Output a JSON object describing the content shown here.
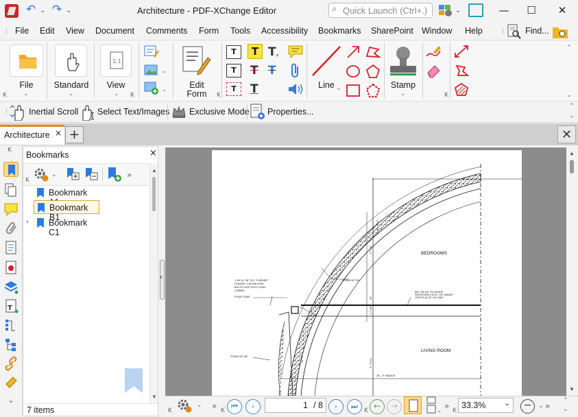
{
  "window": {
    "title": "Architecture - PDF-XChange Editor",
    "quick_launch_placeholder": "Quick Launch (Ctrl+.)",
    "minimize": "—",
    "maximize": "☐",
    "close": "✕"
  },
  "menu": [
    "File",
    "Edit",
    "View",
    "Document",
    "Comments",
    "Form",
    "Tools",
    "Accessibility",
    "Bookmarks",
    "SharePoint",
    "Window",
    "Help"
  ],
  "menu_find": "Find...",
  "ribbon": {
    "file": "File",
    "standard": "Standard",
    "view": "View",
    "edit_form_line1": "Edit",
    "edit_form_line2": "Form",
    "line": "Line",
    "stamp": "Stamp"
  },
  "toolbar2": {
    "inertial_scroll": "Inertial Scroll",
    "select_text": "Select Text/Images",
    "exclusive_mode": "Exclusive Mode",
    "properties": "Properties..."
  },
  "tabs": {
    "document_tab": "Architecture",
    "close_glyph": "×",
    "new_tab": "+",
    "close_doc": "✕"
  },
  "bookmarks": {
    "title": "Bookmarks",
    "close": "×",
    "items": [
      {
        "label": "Bookmark A1",
        "selected": false,
        "expandable": false
      },
      {
        "label": "Bookmark B1",
        "selected": true,
        "expandable": false
      },
      {
        "label": "Bookmark C1",
        "selected": false,
        "expandable": true
      }
    ],
    "count": "7 items"
  },
  "drawing": {
    "bedrooms": "BEDROOMS",
    "living_room": "LIVING ROOM",
    "note1_l1": "1 3/4\"x1 7/8\" SCL \"CURVED\"",
    "note1_l2": "LEDGER, C/W ANCHOR",
    "note1_l3": "BOLTS CAST INTO CONC",
    "note1_l4": "CORBEL",
    "pour_joint": "POUR JOINT",
    "form_set_b3": "FORM SET B3",
    "form_set_b2": "FORM SET B2",
    "plywood_l1": "5/8\" OR 3/4\" PLYWOOD",
    "plywood_l2": "SHEATHING ON 11 7/8\" MANUF.",
    "plywood_l3": "JOISTS @ 16\" O/C MAX",
    "radius": "18' - 0\" RADIUS",
    "dim1": "11' - 4 3/4\"",
    "dim2": "1'-7 3/8\"",
    "dim3": "1'-7 3/8\"",
    "dim4": "9' - 5 3/4\"",
    "dim5": "10' - 0\"",
    "dim6": "10\""
  },
  "navigation": {
    "current_page": "1",
    "total_pages": "/ 8",
    "zoom": "33.3%"
  }
}
